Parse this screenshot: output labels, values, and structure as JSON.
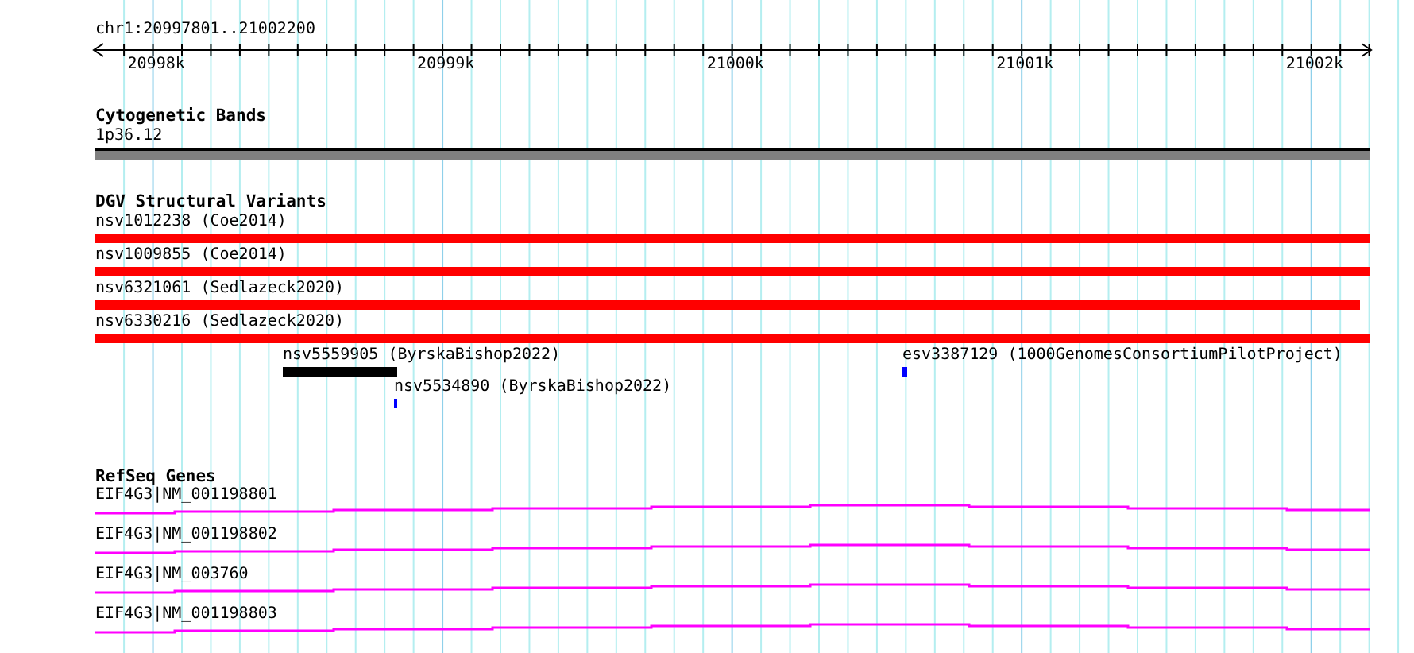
{
  "ruler": {
    "region": "chr1:20997801..21002200",
    "ticks": [
      "20998k",
      "20999k",
      "21000k",
      "21001k",
      "21002k"
    ]
  },
  "cytogenetic_bands": {
    "title": "Cytogenetic Bands",
    "bands": [
      {
        "label": "1p36.12"
      }
    ]
  },
  "dgv_structural_variants": {
    "title": "DGV Structural Variants",
    "features": [
      {
        "label": "nsv1012238 (Coe2014)",
        "color": "#ff0000"
      },
      {
        "label": "nsv1009855 (Coe2014)",
        "color": "#ff0000"
      },
      {
        "label": "nsv6321061 (Sedlazeck2020)",
        "color": "#ff0000"
      },
      {
        "label": "nsv6330216 (Sedlazeck2020)",
        "color": "#ff0000"
      },
      {
        "label": "nsv5559905 (ByrskaBishop2022)",
        "color": "#000000"
      },
      {
        "label": "nsv5534890 (ByrskaBishop2022)",
        "color": "#0000ff"
      },
      {
        "label": "esv3387129 (1000GenomesConsortiumPilotProject)",
        "color": "#0000ff"
      }
    ]
  },
  "refseq_genes": {
    "title": "RefSeq Genes",
    "transcripts": [
      {
        "label": "EIF4G3|NM_001198801"
      },
      {
        "label": "EIF4G3|NM_001198802"
      },
      {
        "label": "EIF4G3|NM_003760"
      },
      {
        "label": "EIF4G3|NM_001198803"
      }
    ]
  }
}
